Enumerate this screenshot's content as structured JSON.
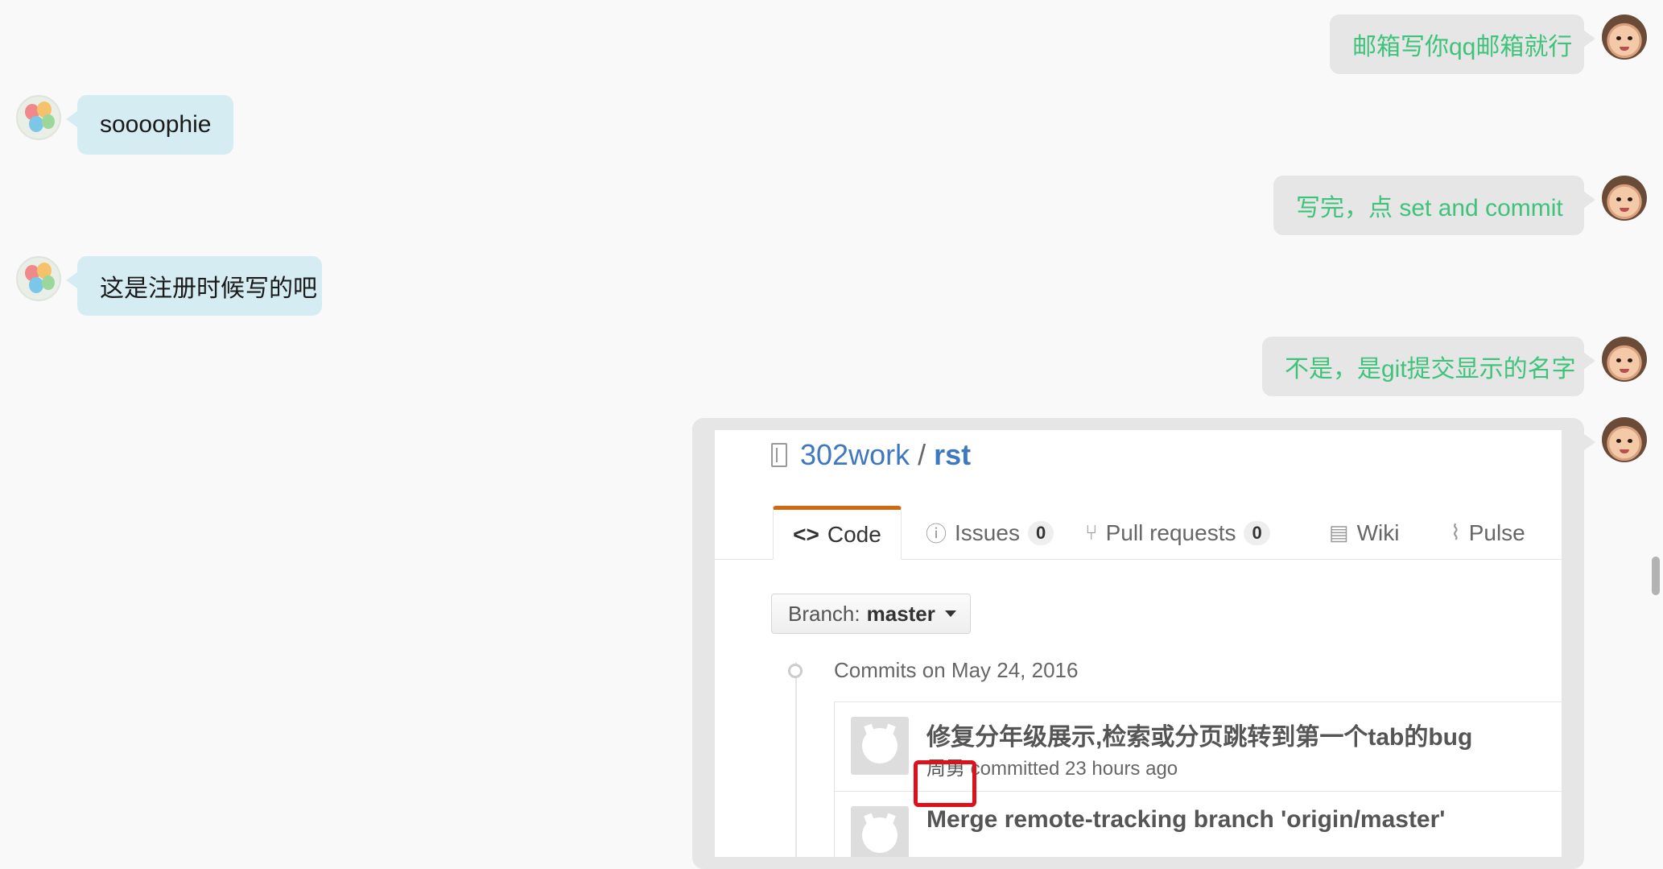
{
  "messages": [
    {
      "side": "right",
      "text": "邮箱写你qq邮箱就行"
    },
    {
      "side": "left",
      "text": "soooophie"
    },
    {
      "side": "right",
      "text": "写完，点 set and commit"
    },
    {
      "side": "left",
      "text": "这是注册时候写的吧"
    },
    {
      "side": "right",
      "text": "不是，是git提交显示的名字"
    }
  ],
  "screenshot": {
    "owner": "302work",
    "separator": "/",
    "repo": "rst",
    "tabs": [
      {
        "label": "Code",
        "icon": "code-icon",
        "selected": true
      },
      {
        "label": "Issues",
        "icon": "issue-icon",
        "count": "0"
      },
      {
        "label": "Pull requests",
        "icon": "pull-request-icon",
        "count": "0"
      },
      {
        "label": "Wiki",
        "icon": "book-icon"
      },
      {
        "label": "Pulse",
        "icon": "pulse-icon"
      }
    ],
    "branch_label": "Branch:",
    "branch_name": "master",
    "commits_date": "Commits on May 24, 2016",
    "commits": [
      {
        "title": "修复分年级展示,检索或分页跳转到第一个tab的bug",
        "author": "周勇",
        "meta": " committed 23 hours ago"
      },
      {
        "title": "Merge remote-tracking branch 'origin/master'",
        "author": "",
        "meta": ""
      }
    ]
  },
  "colors": {
    "sent_text": "#3fc37a",
    "sent_bg": "#e6e6e6",
    "received_bg": "#d6ecf3",
    "highlight": "#e0101a",
    "link": "#4078c0",
    "tab_accent": "#d26911"
  }
}
